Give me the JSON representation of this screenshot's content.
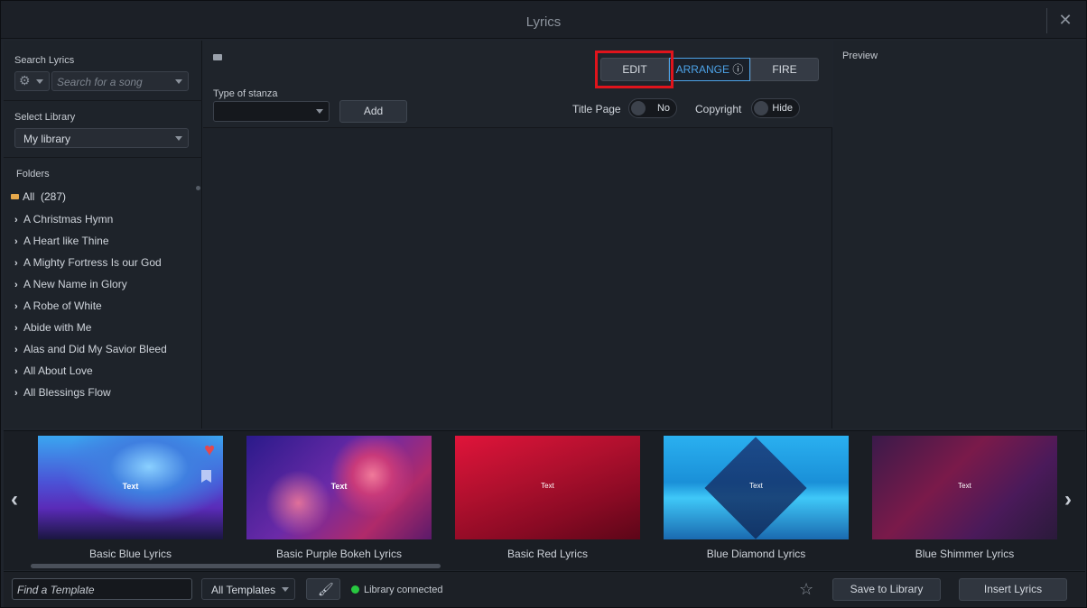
{
  "window": {
    "title": "Lyrics"
  },
  "left": {
    "search_label": "Search Lyrics",
    "search_placeholder": "Search for a song",
    "library_label": "Select Library",
    "library_value": "My library",
    "folders_label": "Folders",
    "all_label": "All",
    "all_count": "(287)",
    "folders": [
      "A Christmas Hymn",
      "A Heart like Thine",
      "A Mighty Fortress Is our God",
      "A New Name in Glory",
      "A Robe of White",
      "Abide with Me",
      "Alas and Did My Savior Bleed",
      "All About Love",
      "All Blessings Flow"
    ]
  },
  "center": {
    "stanza_label": "Type of stanza",
    "stanza_value": "",
    "add_label": "Add",
    "modes": {
      "edit": "EDIT",
      "arrange": "ARRANGE",
      "arrange_icon": "ⓘ",
      "fire": "FIRE"
    },
    "title_page_label": "Title Page",
    "title_page_value": "No",
    "copyright_label": "Copyright",
    "copyright_value": "Hide"
  },
  "preview": {
    "label": "Preview"
  },
  "templates": [
    {
      "name": "Basic Blue Lyrics",
      "text": "Text",
      "favorite": true
    },
    {
      "name": "Basic Purple Bokeh Lyrics",
      "text": "Text",
      "favorite": false
    },
    {
      "name": "Basic Red Lyrics",
      "text": "Text",
      "favorite": false
    },
    {
      "name": "Blue Diamond Lyrics",
      "text": "Text",
      "favorite": false
    },
    {
      "name": "Blue Shimmer Lyrics",
      "text": "Text",
      "favorite": false
    }
  ],
  "bottom": {
    "find_placeholder": "Find a Template",
    "filter_value": "All Templates",
    "status": "Library connected",
    "save_label": "Save to Library",
    "insert_label": "Insert Lyrics"
  },
  "colors": {
    "accent": "#4da3e8",
    "highlight": "#e0141c",
    "status_ok": "#28c840",
    "heart": "#e5484d"
  }
}
